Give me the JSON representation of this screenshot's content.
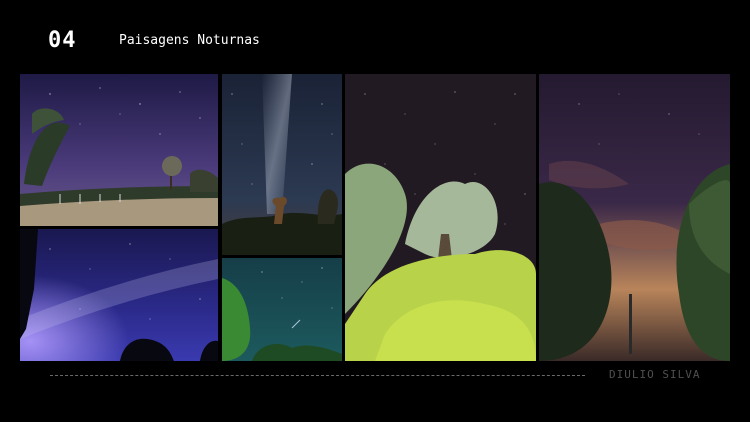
{
  "slide": {
    "number": "04",
    "title": "Paisagens Noturnas"
  },
  "gallery": {
    "photos": [
      {
        "name": "night-field-trees-photo",
        "sky_color": "#3a2f6a"
      },
      {
        "name": "milky-way-dark-trees-photo",
        "sky_color": "#2c3a52"
      },
      {
        "name": "starry-sky-palm-tree-photo",
        "sky_color": "#2b2030"
      },
      {
        "name": "twilight-clouds-trees-photo",
        "sky_color": "#3a2848"
      },
      {
        "name": "milky-way-purple-sky-photo",
        "sky_color": "#2b2a8a"
      },
      {
        "name": "teal-starry-sky-trees-photo",
        "sky_color": "#1c5a5e"
      }
    ]
  },
  "footer": {
    "author": "DIULIO SILVA"
  },
  "colors": {
    "background": "#000000",
    "text_primary": "#ffffff",
    "text_muted": "#4f4f4f",
    "divider": "#6a6a6a"
  }
}
